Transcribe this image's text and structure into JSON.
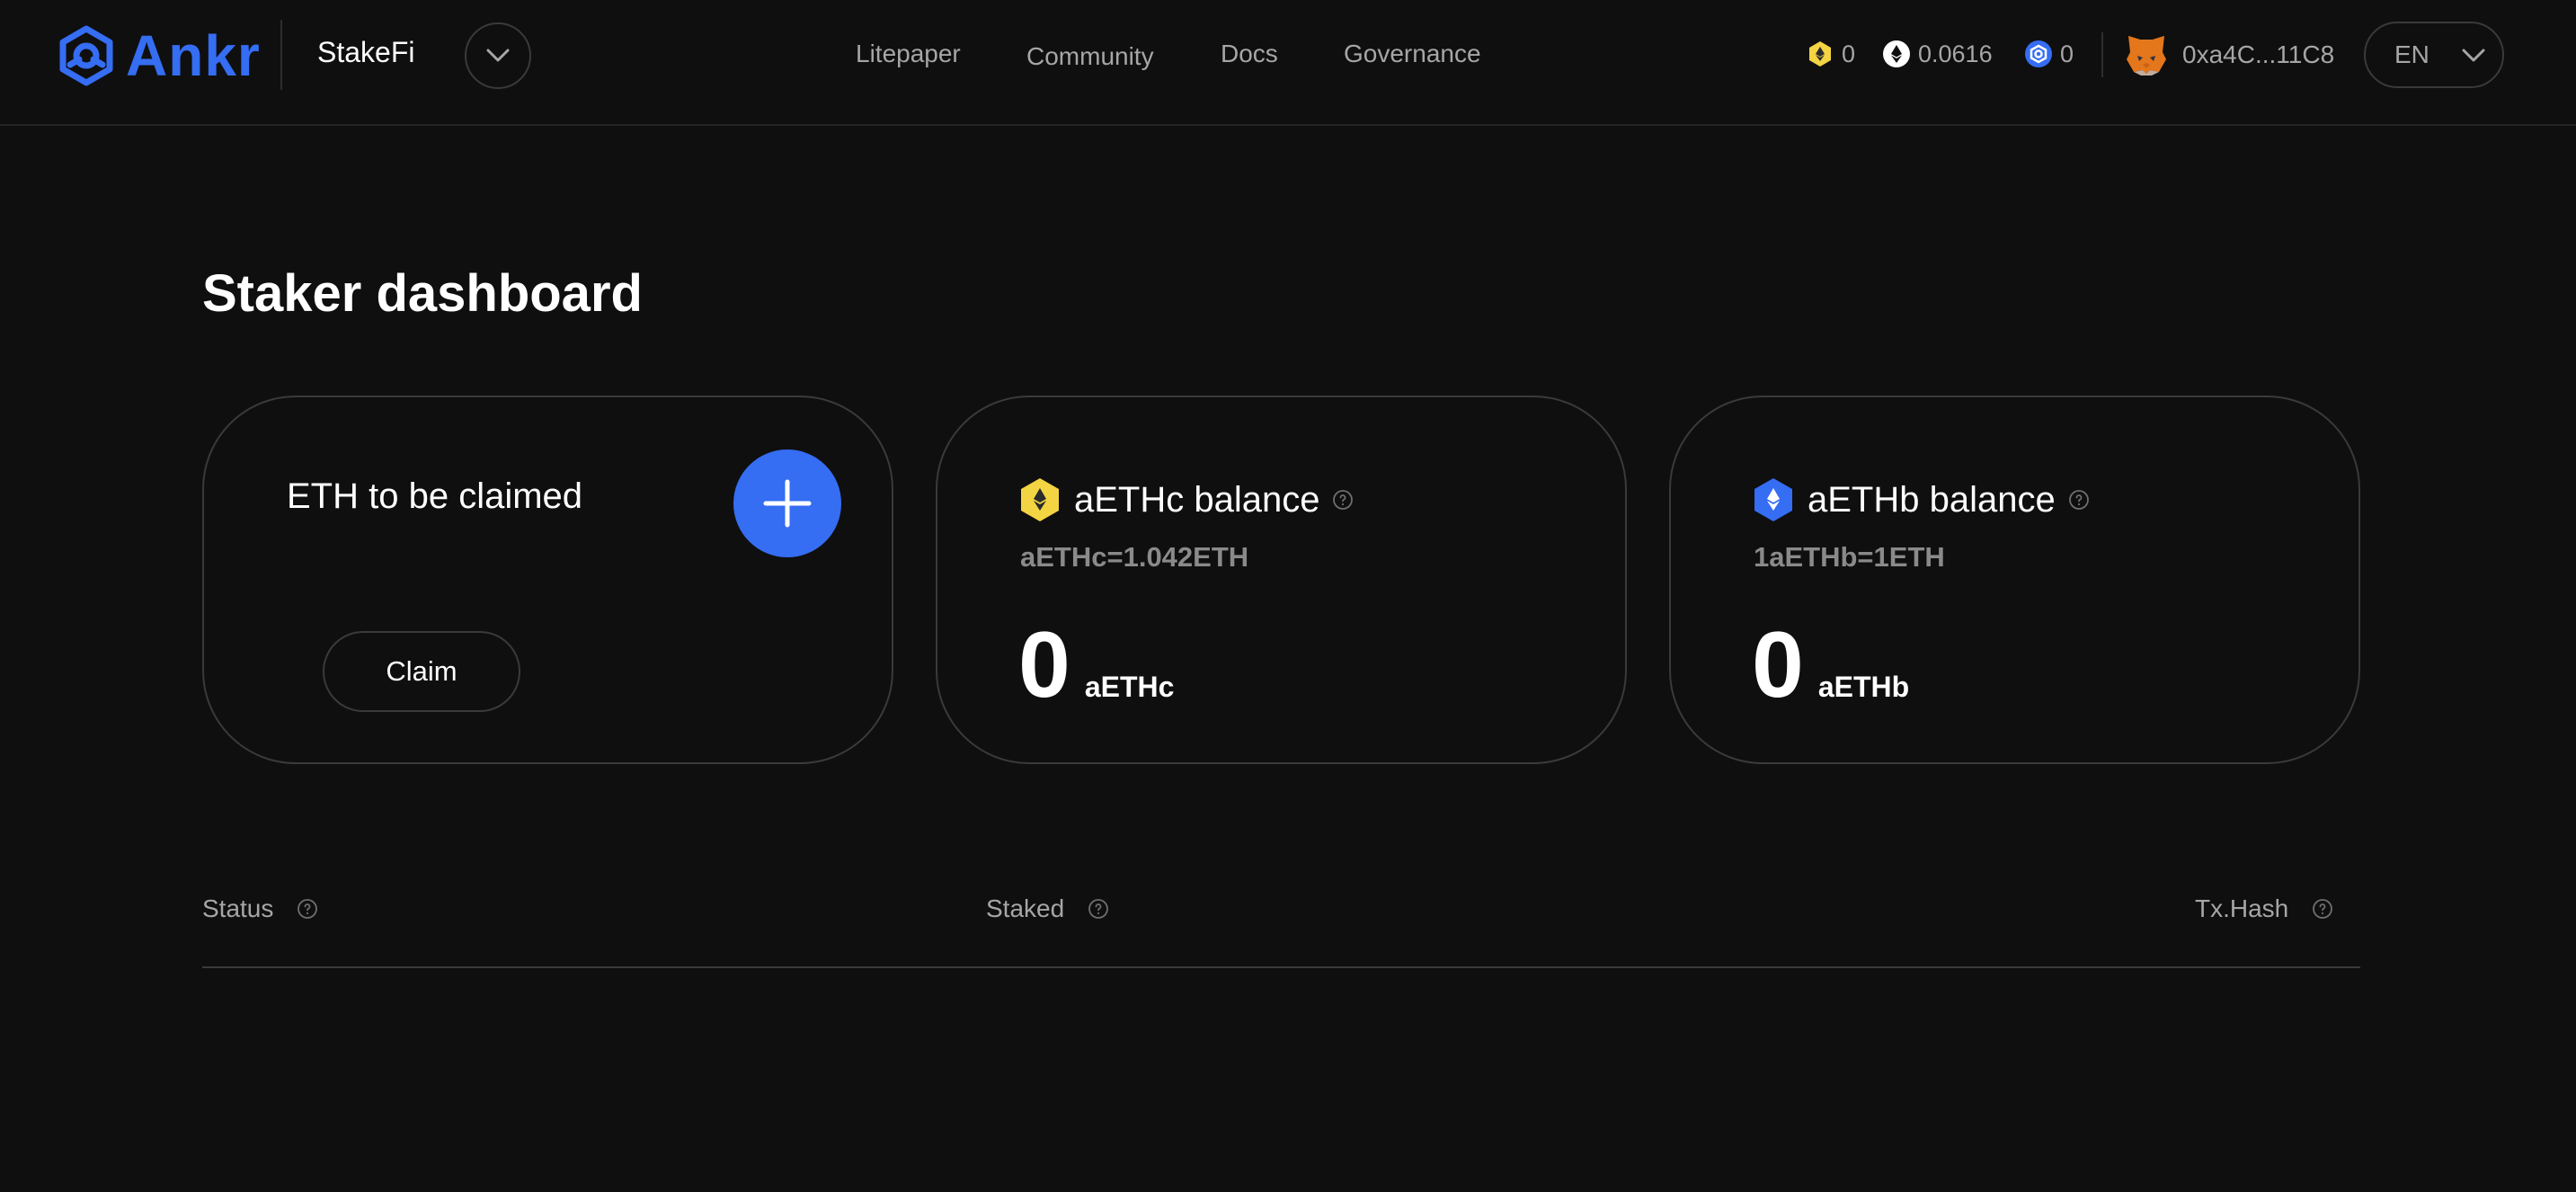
{
  "header": {
    "brand": "Ankr",
    "product": "StakeFi",
    "nav": [
      "Litepaper",
      "Community",
      "Docs",
      "Governance"
    ],
    "balances": [
      {
        "icon": "aethc-token-icon",
        "value": "0",
        "color": "#f3d443"
      },
      {
        "icon": "eth-token-icon",
        "value": "0.0616",
        "color": "#ffffff"
      },
      {
        "icon": "ankr-token-icon",
        "value": "0",
        "color": "#356df3"
      }
    ],
    "wallet_address": "0xa4C...11C8",
    "language": "EN"
  },
  "main": {
    "title": "Staker dashboard",
    "cards": [
      {
        "title": "ETH to be claimed",
        "button": "Claim"
      },
      {
        "title": "aETHc balance",
        "rate": "aETHc=1.042ETH",
        "amount": "0",
        "unit": "aETHc"
      },
      {
        "title": "aETHb balance",
        "rate": "1aETHb=1ETH",
        "amount": "0",
        "unit": "aETHb"
      }
    ],
    "table": {
      "columns": [
        "Status",
        "Staked",
        "Tx.Hash"
      ]
    }
  },
  "colors": {
    "background": "#0f0f0f",
    "accent": "#356df3",
    "muted_text": "#a6a6a6",
    "border": "#3a3a3a"
  }
}
